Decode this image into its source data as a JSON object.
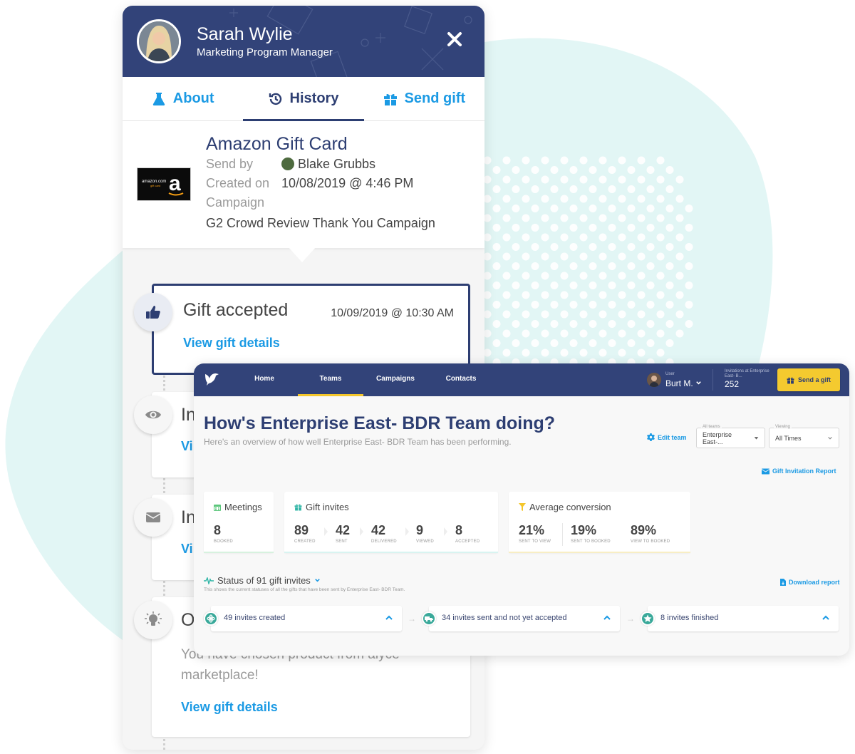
{
  "profile": {
    "name": "Sarah Wylie",
    "role": "Marketing Program Manager",
    "close_icon": "close-icon",
    "tabs": [
      {
        "label": "About",
        "icon": "flask-icon",
        "active": false
      },
      {
        "label": "History",
        "icon": "history-icon",
        "active": true
      },
      {
        "label": "Send gift",
        "icon": "gift-icon",
        "active": false
      }
    ],
    "gift": {
      "title": "Amazon Gift Card",
      "send_by_label": "Send by",
      "send_by_value": "Blake Grubbs",
      "created_on_label": "Created on",
      "created_on_value": "10/08/2019 @ 4:46 PM",
      "campaign_label": "Campaign",
      "campaign_value": "G2 Crowd Review Thank You Campaign",
      "thumb_text": "amazon.com gift card"
    },
    "timeline": [
      {
        "title": "Gift accepted",
        "date": "10/09/2019 @ 10:30 AM",
        "link": "View gift details",
        "icon": "thumbs-up-icon",
        "active": true
      },
      {
        "title": "In",
        "link": "Vi",
        "icon": "eye-icon",
        "active": false
      },
      {
        "title": "In",
        "link": "Vi",
        "icon": "envelope-icon",
        "active": false
      },
      {
        "title": "O",
        "description": "You have chosen product from alyce marketplace!",
        "link": "View gift details",
        "icon": "lightbulb-icon",
        "active": false
      }
    ]
  },
  "dashboard": {
    "nav": {
      "items": [
        {
          "label": "Home",
          "active": false
        },
        {
          "label": "Teams",
          "active": true
        },
        {
          "label": "Campaigns",
          "active": false
        },
        {
          "label": "Contacts",
          "active": false
        }
      ],
      "user_label": "User",
      "user_name": "Burt M.",
      "invitations_label": "Invitations at Enterprise East- B...",
      "invitations_value": "252",
      "send_gift_label": "Send a gift"
    },
    "title": "How's Enterprise East- BDR Team doing?",
    "subtitle": "Here's an overview of how well Enterprise East- BDR Team has been performing.",
    "edit_team_label": "Edit team",
    "team_select": {
      "legend": "All teams",
      "value": "Enterprise East-..."
    },
    "viewing_select": {
      "legend": "Viewing",
      "value": "All Times"
    },
    "gift_invitation_report_label": "Gift Invitation Report",
    "meetings": {
      "title": "Meetings",
      "value": "8",
      "label": "BOOKED",
      "accent": "#7ed39b"
    },
    "gift_invites": {
      "title": "Gift invites",
      "accent": "#9fe0d9",
      "items": [
        {
          "value": "89",
          "label": "CREATED"
        },
        {
          "value": "42",
          "label": "SENT"
        },
        {
          "value": "42",
          "label": "DELIVERED"
        },
        {
          "value": "9",
          "label": "VIEWED"
        },
        {
          "value": "8",
          "label": "ACCEPTED"
        }
      ]
    },
    "conversion": {
      "title": "Average conversion",
      "accent": "#f6e7a8",
      "items": [
        {
          "value": "21%",
          "label": "SENT TO VIEW"
        },
        {
          "value": "19%",
          "label": "SENT TO BOOKED"
        },
        {
          "value": "89%",
          "label": "VIEW TO BOOKED"
        }
      ]
    },
    "status": {
      "title": "Status of 91 gift invites",
      "subtitle": "This shows the current statuses of all the gifts that have been sent by Enterprise East- BDR Team.",
      "download_label": "Download report",
      "cards": [
        {
          "label": "49 invites created",
          "icon": "atom-icon"
        },
        {
          "label": "34 invites sent and not yet accepted",
          "icon": "truck-icon"
        },
        {
          "label": "8 invites finished",
          "icon": "star-icon"
        }
      ]
    }
  }
}
